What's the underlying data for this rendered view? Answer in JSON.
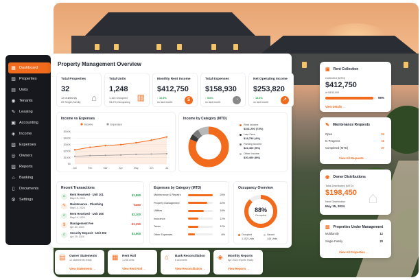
{
  "sidebar": {
    "items": [
      {
        "label": "Dashboard",
        "icon": "dashboard-icon",
        "glyph": "▦"
      },
      {
        "label": "Properties",
        "icon": "building-icon",
        "glyph": "▥"
      },
      {
        "label": "Units",
        "icon": "grid-icon",
        "glyph": "▤"
      },
      {
        "label": "Tenants",
        "icon": "users-icon",
        "glyph": "◉"
      },
      {
        "label": "Leasing",
        "icon": "key-icon",
        "glyph": "✎"
      },
      {
        "label": "Accounting",
        "icon": "ledger-icon",
        "glyph": "▣"
      },
      {
        "label": "Income",
        "icon": "income-icon",
        "glyph": "◈"
      },
      {
        "label": "Expenses",
        "icon": "expenses-icon",
        "glyph": "▧"
      },
      {
        "label": "Owners",
        "icon": "owner-icon",
        "glyph": "◎"
      },
      {
        "label": "Reports",
        "icon": "reports-icon",
        "glyph": "▨"
      },
      {
        "label": "Banking",
        "icon": "bank-icon",
        "glyph": "⌂"
      },
      {
        "label": "Documents",
        "icon": "document-icon",
        "glyph": "▯"
      },
      {
        "label": "Settings",
        "icon": "gear-icon",
        "glyph": "⚙"
      }
    ]
  },
  "header": {
    "title": "Property Management Overview"
  },
  "kpis": [
    {
      "label": "Total Properties",
      "value": "32",
      "s1": "12 Multifamily",
      "s2": "20 Single-Family"
    },
    {
      "label": "Total Units",
      "value": "1,248",
      "s1": "1,163 Occupied",
      "s2": "93.2% Occupancy"
    },
    {
      "label": "Monthly Rent Income",
      "value": "$412,750",
      "s1": "↑ 10.8%",
      "s2": "vs last month"
    },
    {
      "label": "Total Expenses",
      "value": "$158,930",
      "s1": "↑ 5.6%",
      "s2": "vs last month"
    },
    {
      "label": "Net Operating Income",
      "value": "$253,820",
      "s1": "↑ 13.4%",
      "s2": "vs last month"
    }
  ],
  "income_chart": {
    "title": "Income vs Expenses",
    "legend": [
      "Income",
      "Expenses"
    ],
    "yticks": [
      "$500K",
      "$400K",
      "$300K",
      "$200K",
      "$100K",
      "$0"
    ],
    "months": [
      "Jan",
      "Feb",
      "Mar",
      "Apr",
      "May",
      "Jun",
      "Jul"
    ]
  },
  "chart_data": {
    "type": "line",
    "categories": [
      "Jan",
      "Feb",
      "Mar",
      "Apr",
      "May",
      "Jun",
      "Jul"
    ],
    "series": [
      {
        "name": "Income",
        "values": [
          220,
          260,
          285,
          300,
          330,
          370,
          420
        ]
      },
      {
        "name": "Expenses",
        "values": [
          120,
          130,
          135,
          140,
          150,
          155,
          160
        ]
      }
    ],
    "ylim": [
      0,
      500
    ]
  },
  "income_category": {
    "title": "Income by Category (MTD)",
    "items": [
      {
        "label": "Rent Income",
        "value": "$341,200 (73%)",
        "color": "#f26a1b",
        "pct": 73
      },
      {
        "label": "Late Fees",
        "value": "$18,750 (4%)",
        "color": "#3a3a3a",
        "pct": 4
      },
      {
        "label": "Parking Income",
        "value": "$22,400 (5%)",
        "color": "#7a7a7a",
        "pct": 5
      },
      {
        "label": "Other Income",
        "value": "$30,400 (8%)",
        "color": "#b8b8b8",
        "pct": 8
      }
    ]
  },
  "transactions": {
    "title": "Recent Transactions",
    "items": [
      {
        "name": "Rent Received - Unit 101",
        "date": "May 15, 2024",
        "amount": "$1,850",
        "kind": "income",
        "glyph": "⌂"
      },
      {
        "name": "Maintenance - Plumbing",
        "date": "May 14, 2024",
        "amount": "-$450",
        "kind": "expense",
        "glyph": "✎"
      },
      {
        "name": "Rent Received - Unit 205",
        "date": "May 14, 2024",
        "amount": "$2,100",
        "kind": "income",
        "glyph": "⌂"
      },
      {
        "name": "Management Fee",
        "date": "Apr 30, 2024",
        "amount": "-$1,250",
        "kind": "expense",
        "glyph": "$"
      },
      {
        "name": "Security Deposit - Unit 302",
        "date": "Apr 29, 2024",
        "amount": "$1,500",
        "kind": "income",
        "glyph": "⌂"
      }
    ]
  },
  "expenses_category": {
    "title": "Expenses by Category (MTD)",
    "items": [
      {
        "label": "Maintenance & Repairs",
        "pct": "28%",
        "fill": 0.28
      },
      {
        "label": "Property Management",
        "pct": "22%",
        "fill": 0.22
      },
      {
        "label": "Utilities",
        "pct": "18%",
        "fill": 0.18
      },
      {
        "label": "Insurance",
        "pct": "12%",
        "fill": 0.12
      },
      {
        "label": "Taxes",
        "pct": "12%",
        "fill": 0.12
      },
      {
        "label": "Other Expenses",
        "pct": "8%",
        "fill": 0.08
      }
    ]
  },
  "occupancy": {
    "title": "Occupancy Overview",
    "pct": "88%",
    "label": "Occupied",
    "fill": 0.88,
    "legend": [
      {
        "label": "Occupied",
        "value": "1,102 Units"
      },
      {
        "label": "Vacant",
        "value": "146 Units"
      }
    ]
  },
  "rent_collection": {
    "title": "Rent Collection",
    "collected_label": "Collected (MTD)",
    "amount": "$412,750",
    "of": "of $435,000",
    "pct": "95%",
    "fill": 0.95,
    "link": "View Details →"
  },
  "maintenance": {
    "title": "Maintenance Requests",
    "items": [
      {
        "label": "Open",
        "value": "24"
      },
      {
        "label": "In Progress",
        "value": "11"
      },
      {
        "label": "Completed (MTD)",
        "value": "37"
      }
    ],
    "link": "View All Requests →"
  },
  "owner": {
    "title": "Owner Distributions",
    "total_label": "Total Distributed (MTD)",
    "amount": "$198,450",
    "next_label": "Next Distribution",
    "next_date": "May 15, 2024"
  },
  "under_mgmt": {
    "title": "Properties Under Management",
    "items": [
      {
        "label": "Multifamily",
        "value": "12"
      },
      {
        "label": "Single-Family",
        "value": "20"
      }
    ],
    "link": "View All Properties →"
  },
  "bottom": [
    {
      "title": "Owner Statements",
      "sub": "12 statements ready",
      "link": "View Statements →",
      "glyph": "▤"
    },
    {
      "title": "Rent Roll",
      "sub": "1,248 units",
      "link": "View Rent Roll →",
      "glyph": "▦"
    },
    {
      "title": "Bank Reconciliation",
      "sub": "6 accounts",
      "link": "View Reconciliation →",
      "glyph": "⌂"
    },
    {
      "title": "Monthly Reports",
      "sub": "Apr 2024 reports ready",
      "link": "View Reports →",
      "glyph": "◈"
    }
  ]
}
